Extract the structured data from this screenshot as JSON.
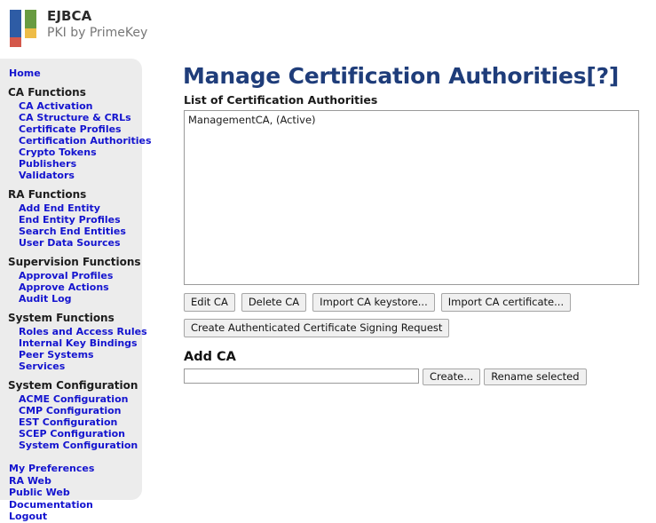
{
  "brand": {
    "title": "EJBCA",
    "subtitle": "PKI by PrimeKey",
    "logo_colors": {
      "blue": "#2e5ca5",
      "red": "#d4584b",
      "green": "#689b41",
      "yellow": "#eebc47"
    }
  },
  "sidebar": {
    "home_label": "Home",
    "groups": [
      {
        "title": "CA Functions",
        "items": [
          "CA Activation",
          "CA Structure & CRLs",
          "Certificate Profiles",
          "Certification Authorities",
          "Crypto Tokens",
          "Publishers",
          "Validators"
        ]
      },
      {
        "title": "RA Functions",
        "items": [
          "Add End Entity",
          "End Entity Profiles",
          "Search End Entities",
          "User Data Sources"
        ]
      },
      {
        "title": "Supervision Functions",
        "items": [
          "Approval Profiles",
          "Approve Actions",
          "Audit Log"
        ]
      },
      {
        "title": "System Functions",
        "items": [
          "Roles and Access Rules",
          "Internal Key Bindings",
          "Peer Systems",
          "Services"
        ]
      },
      {
        "title": "System Configuration",
        "items": [
          "ACME Configuration",
          "CMP Configuration",
          "EST Configuration",
          "SCEP Configuration",
          "System Configuration"
        ]
      }
    ],
    "bottom_items": [
      "My Preferences",
      "RA Web",
      "Public Web",
      "Documentation",
      "Logout"
    ],
    "link_color": "#1414cf",
    "background_color": "#ececec"
  },
  "main": {
    "page_title": "Manage Certification Authorities[?]",
    "list_label": "List of Certification Authorities",
    "ca_list": [
      "ManagementCA, (Active)"
    ],
    "buttons_row1": [
      "Edit CA",
      "Delete CA",
      "Import CA keystore...",
      "Import CA certificate..."
    ],
    "buttons_row2": [
      "Create Authenticated Certificate Signing Request"
    ],
    "add_ca": {
      "heading": "Add CA",
      "input_value": "",
      "input_placeholder": "",
      "create_label": "Create...",
      "rename_label": "Rename selected"
    },
    "title_color": "#1f3d7a"
  }
}
